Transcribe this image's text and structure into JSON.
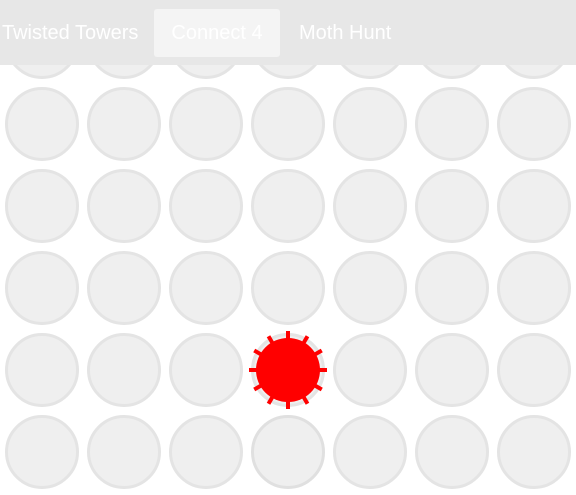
{
  "nav": {
    "items": [
      {
        "label": "Twisted Towers",
        "active": false
      },
      {
        "label": "Connect 4",
        "active": true
      },
      {
        "label": "Moth Hunt",
        "active": false
      }
    ]
  },
  "board": {
    "columns": 7,
    "visible_rows": 6,
    "empty_color": "#efefef",
    "empty_border_color": "#e4e4e4",
    "hover_cell": {
      "row": 5,
      "col": 3
    },
    "pieces": [
      {
        "row": 4,
        "col": 3,
        "player": "red",
        "color": "#ff0000"
      }
    ]
  }
}
